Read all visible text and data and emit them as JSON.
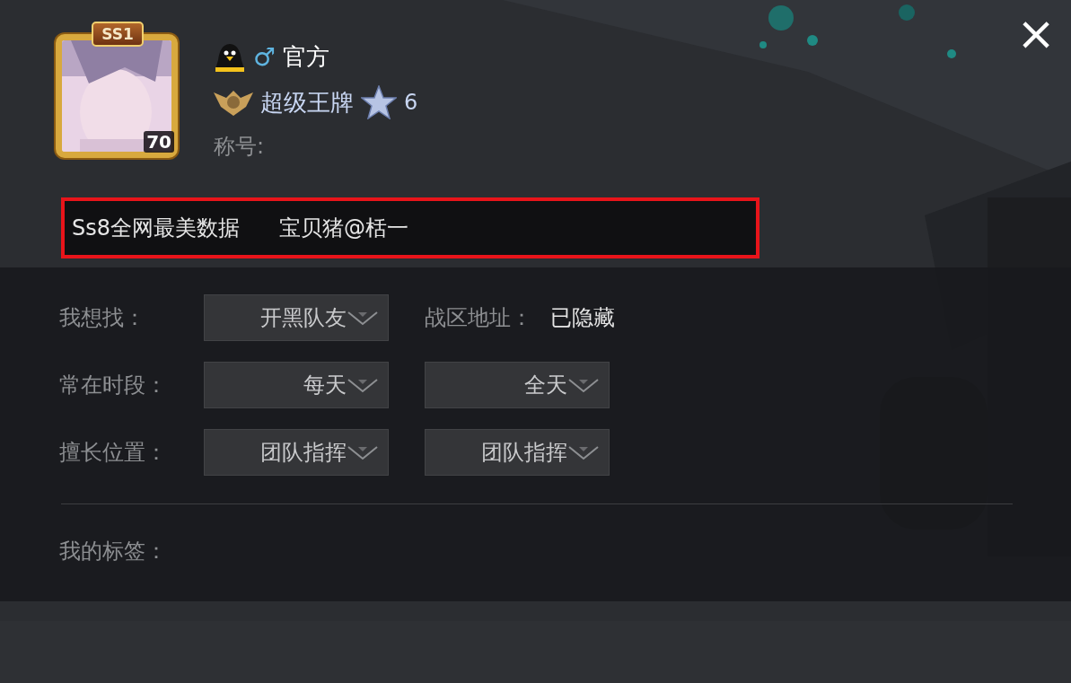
{
  "close_button": {
    "label": "×"
  },
  "profile": {
    "avatar": {
      "kind": "picture",
      "badge": "SS1",
      "level": "70"
    },
    "gender": "♂",
    "name": "官方",
    "rank": "超级王牌",
    "stars_count": "6",
    "title_label": "称号:"
  },
  "signature": {
    "highlighted": true,
    "parts": [
      "Ss8全网最美数据",
      "宝贝猪@栝一"
    ]
  },
  "form_rows": [
    {
      "label": "我想找：",
      "fields": [
        {
          "kind": "dropdown",
          "value": "开黑队友"
        },
        {
          "kind": "info",
          "label": "战区地址：",
          "value": "已隐藏"
        }
      ]
    },
    {
      "label": "常在时段：",
      "fields": [
        {
          "kind": "dropdown",
          "value": "每天"
        },
        {
          "kind": "dropdown",
          "value": "全天"
        }
      ]
    },
    {
      "label": "擅长位置：",
      "fields": [
        {
          "kind": "dropdown",
          "value": "团队指挥"
        },
        {
          "kind": "dropdown",
          "value": "团队指挥"
        }
      ]
    }
  ],
  "tags": {
    "label": "我的标签："
  }
}
